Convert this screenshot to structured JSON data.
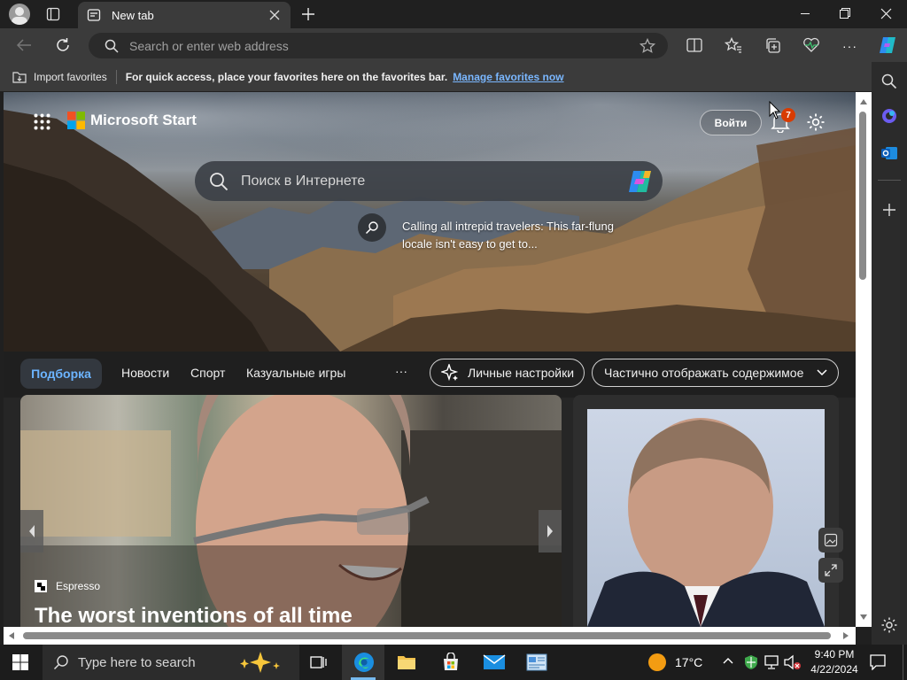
{
  "browser": {
    "tab_title": "New tab",
    "address_placeholder": "Search or enter web address"
  },
  "favorites_bar": {
    "import_label": "Import favorites",
    "hint": "For quick access, place your favorites here on the favorites bar.",
    "manage_link": "Manage favorites now"
  },
  "start_page": {
    "brand": "Microsoft Start",
    "signin_label": "Войти",
    "notification_count": "7",
    "search_placeholder": "Поиск в Интернете",
    "hero_caption": "Calling all intrepid travelers: This far-flung locale isn't easy to get to...",
    "feed_tabs": [
      "Подборка",
      "Новости",
      "Спорт",
      "Казуальные игры"
    ],
    "more_label": "···",
    "personalize_label": "Личные настройки",
    "content_toggle_label": "Частично отображать содержимое",
    "card1": {
      "source": "Espresso",
      "title": "The worst inventions of all time"
    }
  },
  "taskbar": {
    "search_placeholder": "Type here to search",
    "temperature": "17°C",
    "time": "9:40 PM",
    "date": "4/22/2024"
  },
  "colors": {
    "accent_link": "#7ab7ff",
    "active_tab_text": "#6cb4ff",
    "notification_badge": "#d83b01"
  }
}
